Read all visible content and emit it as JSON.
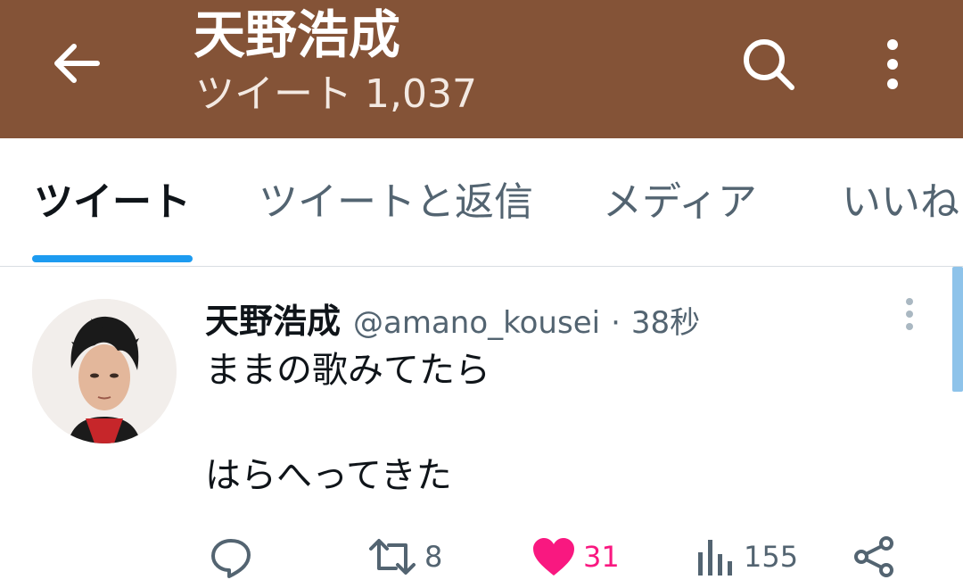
{
  "header": {
    "title": "天野浩成",
    "subtitle": "ツイート 1,037",
    "background": "#845337"
  },
  "tabs": [
    {
      "label": "ツイート",
      "active": true
    },
    {
      "label": "ツイートと返信",
      "active": false
    },
    {
      "label": "メディア",
      "active": false
    },
    {
      "label": "いいね",
      "active": false
    }
  ],
  "tweet": {
    "author_name": "天野浩成",
    "handle": "@amano_kousei",
    "separator": "·",
    "time": "38秒",
    "lines": [
      "ままの歌みてたら",
      "はらへってきた"
    ],
    "actions": {
      "reply": {
        "icon": "reply-icon"
      },
      "retweet": {
        "icon": "retweet-icon",
        "count": "8"
      },
      "like": {
        "icon": "heart-icon",
        "count": "31",
        "color": "#f91880",
        "liked": true
      },
      "views": {
        "icon": "views-icon",
        "count": "155"
      },
      "share": {
        "icon": "share-icon"
      }
    }
  },
  "colors": {
    "accent": "#1d9bf0",
    "text_primary": "#0f1419",
    "text_secondary": "#536471"
  }
}
